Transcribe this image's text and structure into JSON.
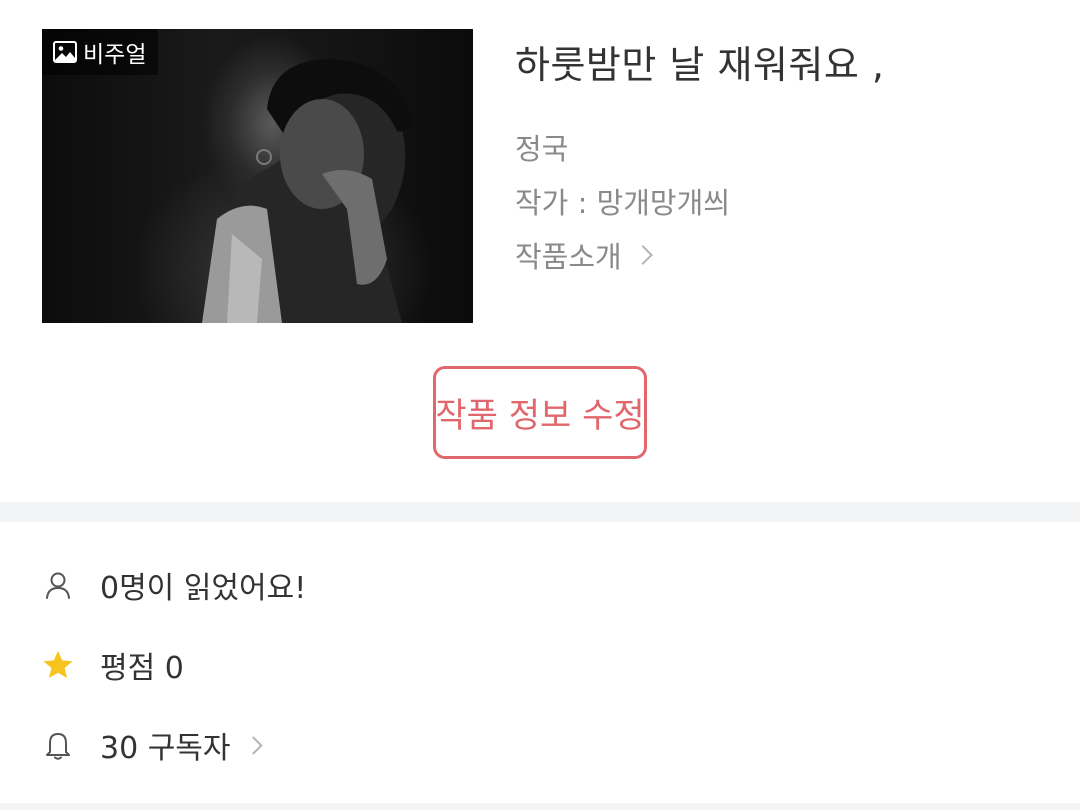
{
  "work": {
    "title": "하룻밤만 날 재워줘요 ,",
    "genre": "정국",
    "author": "작가 : 망개망개씌",
    "intro_label": "작품소개",
    "visual_badge": "비주얼",
    "thumbnail_icon": "image-icon"
  },
  "actions": {
    "edit_label": "작품 정보 수정"
  },
  "stats": {
    "readers_text": "0명이 읽었어요!",
    "rating_text": "평점 0",
    "subscribers_text": "30 구독자"
  },
  "colors": {
    "accent": "#e0676c",
    "star": "#f7c31e",
    "divider": "#f2f3f5"
  }
}
